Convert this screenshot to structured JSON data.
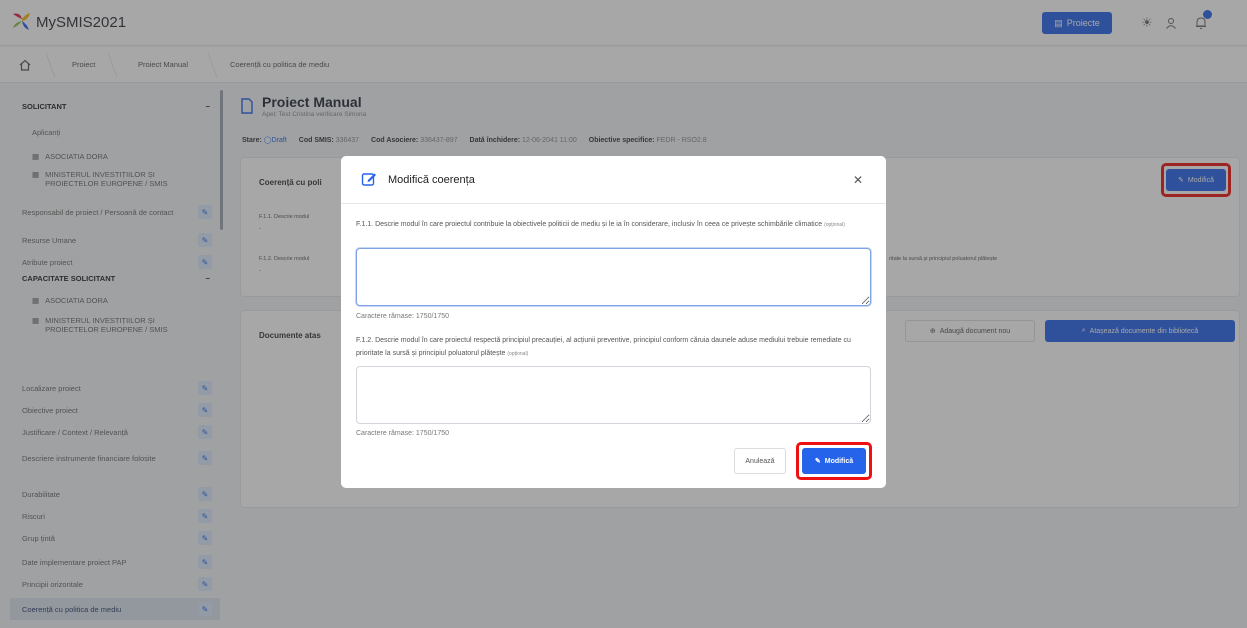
{
  "app": {
    "name": "MySMIS2021"
  },
  "topbar": {
    "projects_label": "Proiecte"
  },
  "breadcrumb": [
    "Proiect",
    "Proiect Manual",
    "Coerență cu politica de mediu"
  ],
  "sidebar": {
    "section1": "SOLICITANT",
    "applicants_label": "Aplicanți",
    "applicants": [
      "ASOCIATIA DORA",
      "MINISTERUL INVESTIȚIILOR ȘI PROIECTELOR EUROPENE / SMIS"
    ],
    "items_a": [
      "Responsabil de proiect / Persoană de contact",
      "Resurse Umane",
      "Atribute proiect"
    ],
    "section2": "CAPACITATE SOLICITANT",
    "capacity": [
      "ASOCIATIA DORA",
      "MINISTERUL INVESTIȚIILOR ȘI PROIECTELOR EUROPENE / SMIS"
    ],
    "items_b": [
      "Localizare proiect",
      "Obiective proiect",
      "Justificare / Context / Relevanță",
      "Descriere instrumente financiare folosite",
      "Durabilitate",
      "Riscuri",
      "Grup țintă",
      "Date implementare proiect PAP",
      "Principii orizontale",
      "Coerență cu politica de mediu"
    ]
  },
  "page": {
    "title": "Proiect Manual",
    "subtitle": "Apel: Test Cristina verificare Simona",
    "meta": {
      "stare_label": "Stare:",
      "stare": "Draft",
      "cod_smis_label": "Cod SMIS:",
      "cod_smis": "336437",
      "cod_asociere_label": "Cod Asociere:",
      "cod_asociere": "336437-897",
      "data_label": "Dată închidere:",
      "data": "12-06-2041 11:00",
      "obiective_label": "Obiective specifice:",
      "obiective": "FEDR - RSO2.8"
    },
    "card1_title": "Coerență cu poli",
    "card1_modify": "Modifică",
    "f11_short": "F.1.1. Descrie modul",
    "f12_short": "F.1.2. Descrie modul",
    "f12_tail": "ritate la sursă și principiul poluatorul plătește",
    "dash": "-",
    "card2_title": "Documente atas",
    "add_doc": "Adaugă document nou",
    "attach_doc": "Atașează documente din bibliotecă"
  },
  "modal": {
    "title": "Modifică coerența",
    "q1": "F.1.1. Descrie modul în care proiectul contribuie la obiectivele politicii de mediu și le ia în considerare, inclusiv în ceea ce privește schimbările climatice",
    "q1_optional": "(opțional)",
    "q1_value": "",
    "counter1": "Caractere rămase: 1750/1750",
    "q2": "F.1.2. Descrie modul în care proiectul respectă principiul precauției, al acțiunii preventive, principiul conform căruia daunele aduse mediului trebuie remediate cu prioritate la sursă și principiul poluatorul plătește",
    "q2_optional": "(opțional)",
    "q2_value": "",
    "counter2": "Caractere rămase: 1750/1750",
    "cancel_label": "Anulează",
    "modify_label": "Modifică"
  },
  "colors": {
    "primary": "#2563eb",
    "highlight": "#ee1111"
  }
}
